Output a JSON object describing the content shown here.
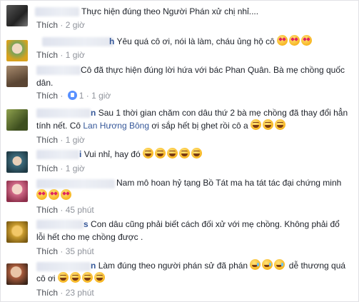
{
  "comments": [
    {
      "text": "Thực hiện đúng theo Người Phán xử chị nhỉ....",
      "emojis": [],
      "action": "Thích",
      "time": "2 giờ",
      "likes": "",
      "avatar_color": "#3a3a3a"
    },
    {
      "text": "Yêu quá cô ơi, nói là làm, cháu ủng hộ cô",
      "emojis": [
        "heart-eyes-icon",
        "heart-eyes-icon",
        "heart-eyes-icon"
      ],
      "action": "Thích",
      "time": "1 giờ",
      "likes": "",
      "name_visible": "h",
      "avatar_color": "#7aa35a"
    },
    {
      "text": "Cô đã thực hiện đúng lời hứa với bác Phan Quân. Bà mẹ chồng quốc dân.",
      "emojis": [],
      "action": "Thích",
      "time": "1 giờ",
      "likes": "1",
      "avatar_color": "#8a6e55"
    },
    {
      "text_before": "Sau 1 thời gian chăm con dâu thứ 2 bà mẹ chồng đã thay đổi hẳn tính nết. Cô ",
      "tag": "Lan Hương Bông",
      "text_after": " ơi sắp hết bị ghet rồi cô a",
      "emojis": [
        "laugh-icon",
        "laugh-icon",
        "laugh-icon"
      ],
      "action": "Thích",
      "time": "1 giờ",
      "likes": "",
      "name_visible": "n",
      "avatar_color": "#6b7d3e"
    },
    {
      "text": "Vui nhỉ, hay đó",
      "emojis": [
        "laugh-icon",
        "laugh-icon",
        "laugh-icon",
        "laugh-icon",
        "laugh-icon"
      ],
      "action": "Thích",
      "time": "1 giờ",
      "likes": "",
      "name_visible": "i",
      "avatar_color": "#3d6b7c"
    },
    {
      "text": "Nam mô hoan hỷ tạng Bồ Tát ma ha tát tác đại chứng minh",
      "emojis": [
        "heart-eyes-icon",
        "heart-eyes-icon",
        "heart-eyes-icon"
      ],
      "action": "Thích",
      "time": "45 phút",
      "likes": "",
      "avatar_color": "#c0506e"
    },
    {
      "text": "Con dâu cũng phải biết cách đối xử với mẹ chồng. Không phải đổ lỗi hết cho mẹ chồng được .",
      "emojis": [],
      "action": "Thích",
      "time": "35 phút",
      "likes": "",
      "name_visible": "s",
      "avatar_color": "#c79a2e"
    },
    {
      "text_before": "Làm đúng theo người phán sử đã phán ",
      "text_middle": " dễ thương quá cô ơi",
      "emojis_inline": [
        "tears-of-joy-icon",
        "tears-of-joy-icon",
        "tears-of-joy-icon"
      ],
      "emojis": [
        "laugh-icon",
        "laugh-icon",
        "laugh-icon",
        "laugh-icon"
      ],
      "action": "Thích",
      "time": "23 phút",
      "likes": "",
      "name_visible": "n",
      "avatar_color": "#a85b3c"
    }
  ]
}
